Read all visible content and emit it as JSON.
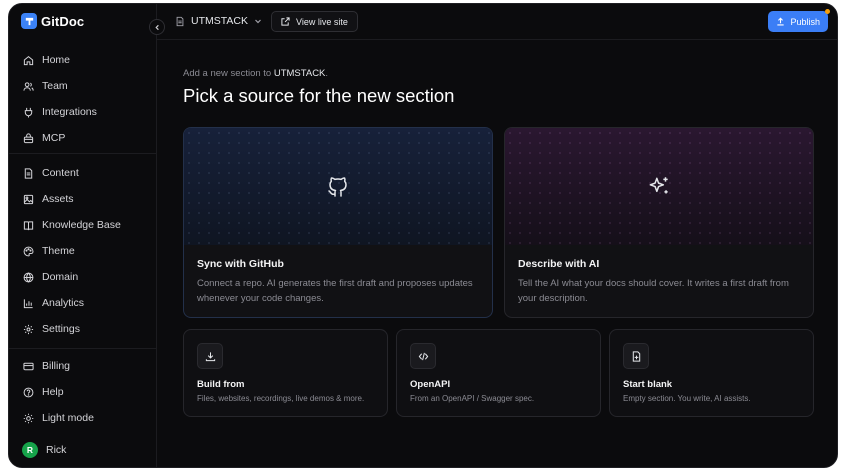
{
  "app": {
    "name": "GitDoc"
  },
  "topbar": {
    "project_name": "UTMSTACK",
    "view_live_label": "View live site",
    "publish_label": "Publish"
  },
  "sidebar": {
    "group1": [
      {
        "label": "Home",
        "icon": "home-icon"
      },
      {
        "label": "Team",
        "icon": "team-icon"
      },
      {
        "label": "Integrations",
        "icon": "plug-icon"
      },
      {
        "label": "MCP",
        "icon": "mcp-icon"
      }
    ],
    "group2": [
      {
        "label": "Content",
        "icon": "document-icon"
      },
      {
        "label": "Assets",
        "icon": "image-icon"
      },
      {
        "label": "Knowledge Base",
        "icon": "book-icon"
      },
      {
        "label": "Theme",
        "icon": "palette-icon"
      },
      {
        "label": "Domain",
        "icon": "globe-icon"
      },
      {
        "label": "Analytics",
        "icon": "chart-icon"
      },
      {
        "label": "Settings",
        "icon": "gear-icon"
      }
    ],
    "group3": [
      {
        "label": "Billing",
        "icon": "card-icon"
      },
      {
        "label": "Help",
        "icon": "help-icon"
      },
      {
        "label": "Light mode",
        "icon": "sun-icon"
      }
    ],
    "user": {
      "initial": "R",
      "name": "Rick"
    }
  },
  "main": {
    "subtitle_prefix": "Add a new section to",
    "subtitle_project": "UTMSTACK",
    "subtitle_suffix": ".",
    "title": "Pick a source for the new section",
    "cards": {
      "github": {
        "title": "Sync with GitHub",
        "desc": "Connect a repo. AI generates the first draft and proposes updates whenever your code changes."
      },
      "ai": {
        "title": "Describe with AI",
        "desc": "Tell the AI what your docs should cover. It writes a first draft from your description."
      },
      "build": {
        "title": "Build from",
        "desc": "Files, websites, recordings, live demos & more."
      },
      "openapi": {
        "title": "OpenAPI",
        "desc": "From an OpenAPI / Swagger spec."
      },
      "blank": {
        "title": "Start blank",
        "desc": "Empty section. You write, AI assists."
      }
    }
  },
  "colors": {
    "background": "#0b0b0d",
    "accent": "#3b7ef6",
    "avatar": "#16a34a",
    "notification_dot": "#f59e0b"
  }
}
